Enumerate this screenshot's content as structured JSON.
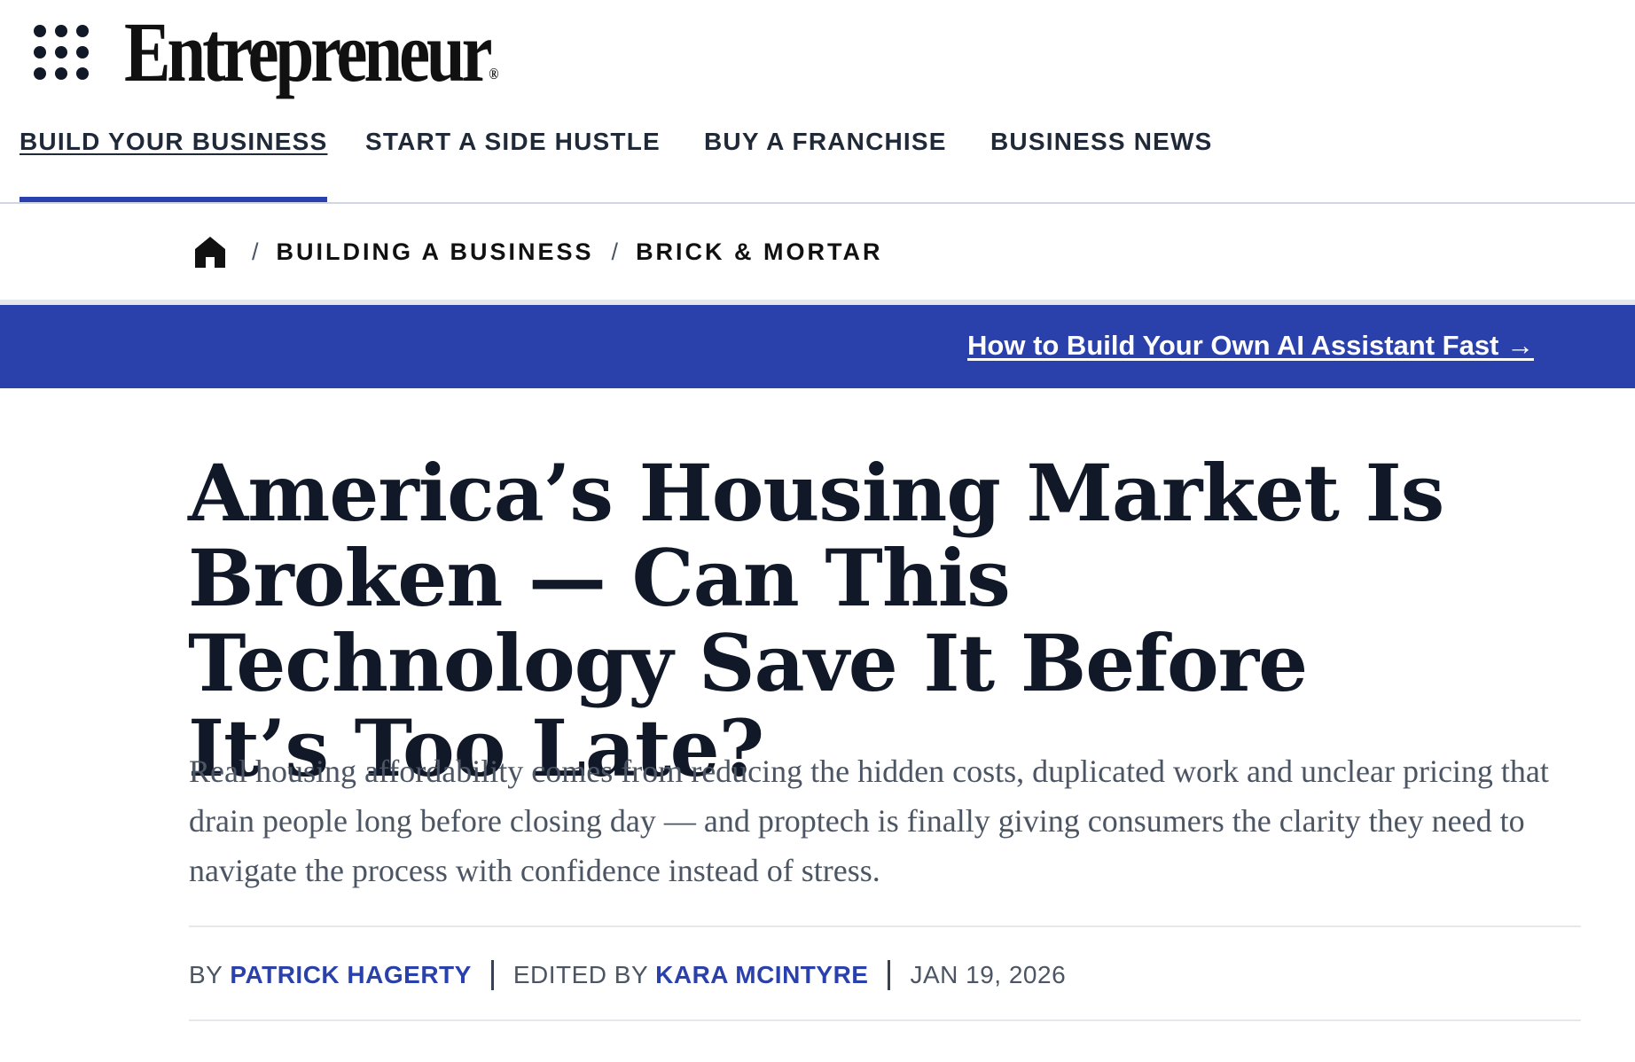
{
  "header": {
    "brand_name": "Entrepreneur",
    "brand_mark": "®",
    "menu_icon": "grid-menu-icon"
  },
  "nav": {
    "items": [
      {
        "label": "BUILD YOUR BUSINESS",
        "active": true
      },
      {
        "label": "START A SIDE HUSTLE",
        "active": false
      },
      {
        "label": "BUY A FRANCHISE",
        "active": false
      },
      {
        "label": "BUSINESS NEWS",
        "active": false
      }
    ]
  },
  "breadcrumb": {
    "home_icon": "home-icon",
    "separator": "/",
    "items": [
      "BUILDING A BUSINESS",
      "BRICK & MORTAR"
    ]
  },
  "promo": {
    "link_text": "How to Build Your Own AI Assistant Fast →",
    "background_color": "#2a41ac"
  },
  "article": {
    "headline": "America’s Housing Market Is Broken — Can This Technology Save It Before It’s Too Late?",
    "deck": "Real housing affordability comes from reducing the hidden costs, duplicated work and unclear pricing that drain people long before closing day — and proptech is finally giving consumers the clarity they need to navigate the process with confidence instead of stress.",
    "byline": {
      "by_label": "BY",
      "author": "PATRICK HAGERTY",
      "edited_label": "EDITED BY",
      "editor": "KARA MCINTYRE",
      "date": "JAN 19, 2026"
    }
  },
  "colors": {
    "accent": "#2a41ac",
    "text_primary": "#111827",
    "text_secondary": "#4b5563"
  }
}
